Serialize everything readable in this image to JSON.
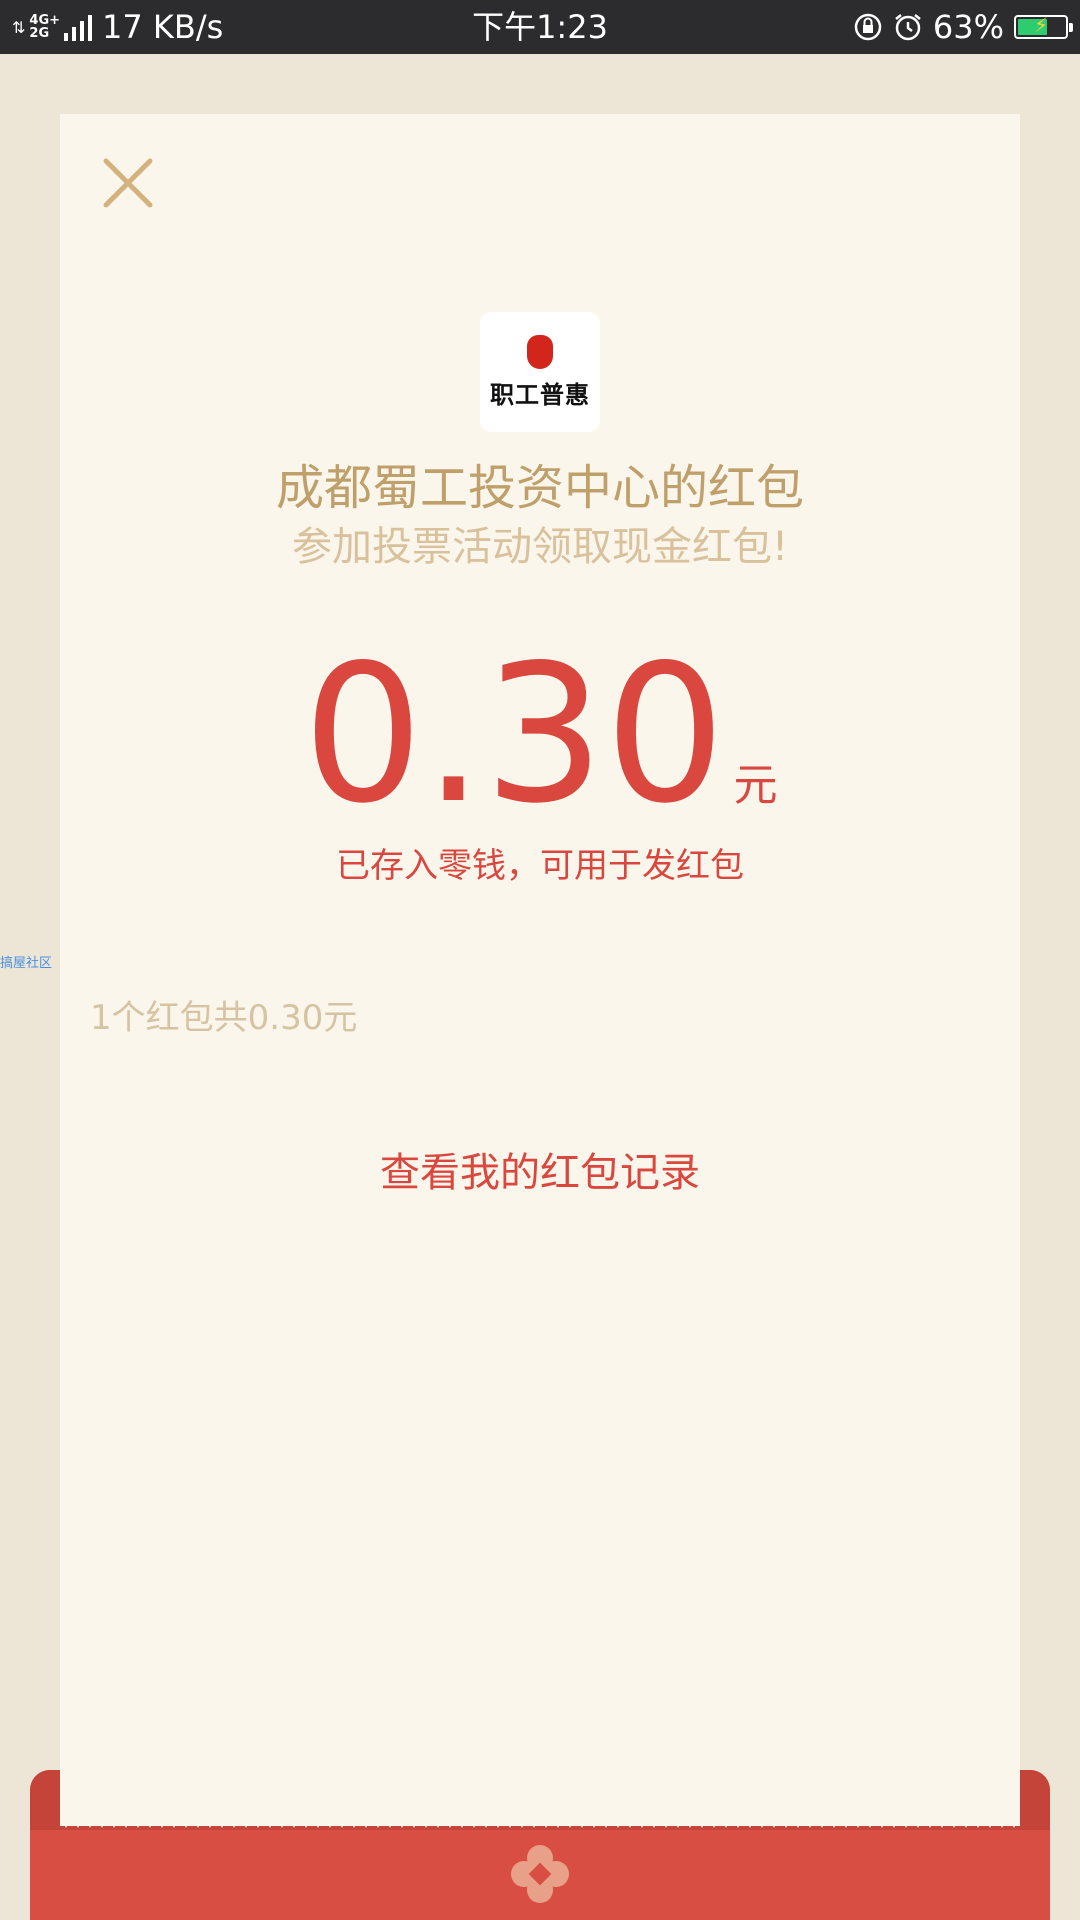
{
  "status_bar": {
    "network_top": "4G+",
    "network_bottom": "2G",
    "speed": "17 KB/s",
    "time": "下午1:23",
    "battery_pct": "63%",
    "battery_level": 0.63,
    "icons": [
      "data-arrows-icon",
      "signal-icon",
      "rotation-lock-icon",
      "alarm-icon",
      "battery-charging-icon"
    ]
  },
  "card": {
    "logo_text": "职工普惠",
    "sender": "成都蜀工投资中心的红包",
    "wishing": "参加投票活动领取现金红包!",
    "amount": "0.30",
    "amount_unit": "元",
    "stored_note": "已存入零钱，可用于发红包",
    "watermark": "搞屋社区",
    "summary": "1个红包共0.30元",
    "records_link": "查看我的红包记录"
  },
  "colors": {
    "page_bg": "#ede6d6",
    "card_bg": "#faf6ec",
    "accent_red": "#d9473e",
    "gold_text": "#c0a06a",
    "light_gold_text": "#d9c19c",
    "envelope_red": "#d94e42"
  }
}
